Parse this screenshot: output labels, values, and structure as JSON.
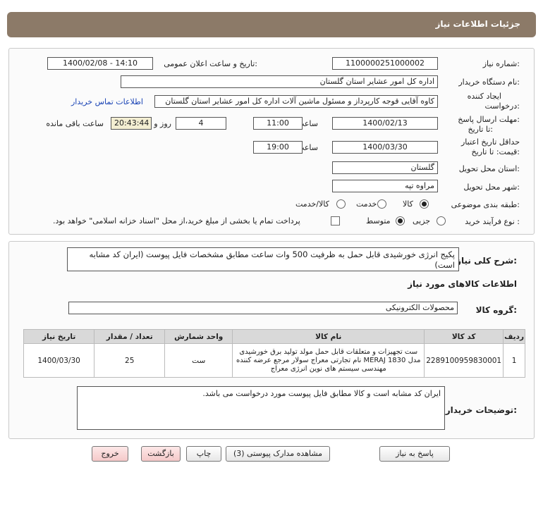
{
  "header": {
    "title": "جزئیات اطلاعات نیاز"
  },
  "form": {
    "need_number_label": "شماره نیاز:",
    "need_number": "1100000251000002",
    "announce_label": "تاریخ و ساعت اعلان عمومی:",
    "announce_value": "1400/02/08 - 14:10",
    "buyer_org_label": "نام دستگاه خریدار:",
    "buyer_org": "اداره کل امور عشایر استان گلستان",
    "requester_label_1": "ایجاد کننده",
    "requester_label_2": "درخواست:",
    "requester": "کاوه آقایی قوجه کارپرداز و مسئول ماشین آلات اداره کل امور عشایر استان گلستان",
    "contact_link": "اطلاعات تماس خریدار",
    "deadline_label_1": "مهلت ارسال پاسخ:",
    "deadline_label_2": "تا تاریخ:",
    "deadline_date": "1400/02/13",
    "time_label": "ساعت",
    "deadline_time": "11:00",
    "days_value": "4",
    "days_label": "روز و",
    "remaining_time": "20:43:44",
    "remaining_label": "ساعت باقی مانده",
    "validity_label_1": "حداقل تاریخ اعتبار",
    "validity_label_2": "قیمت: تا تاریخ:",
    "validity_date": "1400/03/30",
    "validity_time": "19:00",
    "province_label": "استان محل تحویل:",
    "province": "گلستان",
    "city_label": "شهر محل تحویل:",
    "city": "مراوه تپه",
    "category_label": "طبقه بندی موضوعی:",
    "category_options": [
      "کالا",
      "خدمت",
      "کالا/خدمت"
    ],
    "category_selected": "کالا",
    "process_label": "نوع فرآیند خرید :",
    "process_options": [
      "جزیی",
      "متوسط"
    ],
    "process_selected": "متوسط",
    "payment_note": "پرداخت تمام یا بخشی از مبلغ خرید،از محل \"اسناد خزانه اسلامی\" خواهد بود."
  },
  "description": {
    "label": "شرح کلی نیاز:",
    "text": "پکیج انرژی خورشیدی قابل حمل به ظرفیت 500 وات ساعت مطابق مشخصات فایل پیوست (ایران کد مشابه است)"
  },
  "goods": {
    "section_title": "اطلاعات کالاهای مورد نیاز",
    "group_label": "گروه کالا:",
    "group_value": "محصولات الکترونیکی",
    "columns": [
      "ردیف",
      "کد کالا",
      "نام کالا",
      "واحد شمارش",
      "تعداد / مقدار",
      "تاریخ نیاز"
    ],
    "rows": [
      {
        "row": "1",
        "code": "2289100959830001",
        "name": "ست تجهیزات و متعلقات قابل حمل مولد تولید برق خورشیدی مدل MERAJ 1830 نام تجارتی معراج سولار مرجع عرضه کننده مهندسی سیستم های نوین انرژی معراج",
        "unit": "ست",
        "qty": "25",
        "date": "1400/03/30"
      }
    ]
  },
  "buyer_notes": {
    "label": "توضیحات خریدار:",
    "text": "ایران کد مشابه است و کالا مطابق فایل پیوست مورد درخواست می باشد."
  },
  "buttons": {
    "reply": "پاسخ به نیاز",
    "attachments": "مشاهده مدارک پیوستی (3)",
    "print": "چاپ",
    "back": "بازگشت",
    "exit": "خروج"
  }
}
